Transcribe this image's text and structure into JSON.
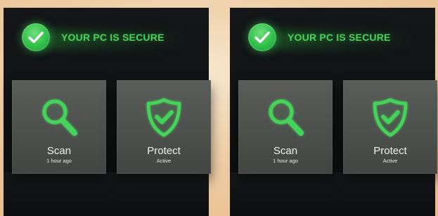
{
  "panels": [
    {
      "status": {
        "text": "YOUR PC IS SECURE",
        "icon": "check-icon",
        "color": "#49d35b"
      },
      "tiles": [
        {
          "title": "Scan",
          "subtitle": "1 hour ago",
          "icon": "magnifier-icon"
        },
        {
          "title": "Protect",
          "subtitle": "Active",
          "icon": "shield-check-icon"
        }
      ]
    },
    {
      "status": {
        "text": "YOUR PC IS SECURE",
        "icon": "check-icon",
        "color": "#49d35b"
      },
      "tiles": [
        {
          "title": "Scan",
          "subtitle": "1 hour ago",
          "icon": "magnifier-icon"
        },
        {
          "title": "Protect",
          "subtitle": "Active",
          "icon": "shield-check-icon"
        }
      ]
    }
  ],
  "theme": {
    "accent": "#49d35b",
    "panel_bg": "#121416",
    "tile_bg": "#50534f",
    "text": "#f3f3f3"
  }
}
